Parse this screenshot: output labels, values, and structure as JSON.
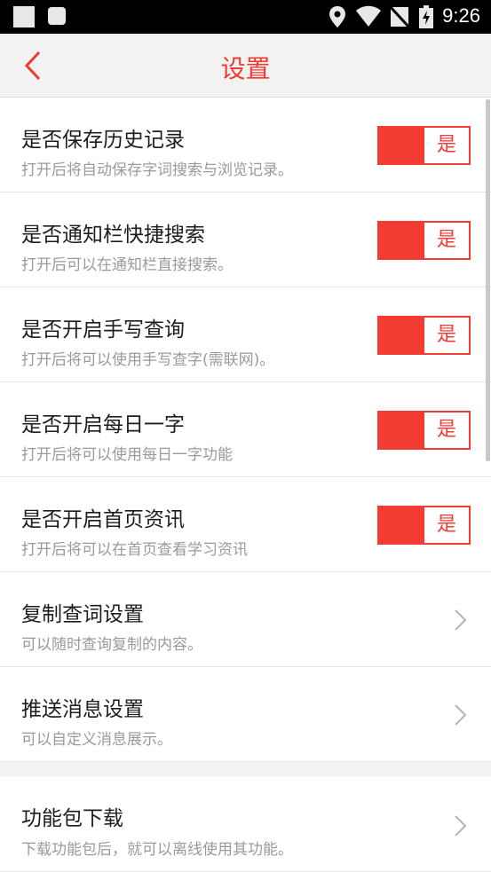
{
  "status_bar": {
    "time": "9:26"
  },
  "header": {
    "title": "设置"
  },
  "settings": [
    {
      "title": "是否保存历史记录",
      "desc": "打开后将自动保存字词搜索与浏览记录。",
      "toggle_label": "是"
    },
    {
      "title": "是否通知栏快捷搜索",
      "desc": "打开后可以在通知栏直接搜索。",
      "toggle_label": "是"
    },
    {
      "title": "是否开启手写查询",
      "desc": "打开后将可以使用手写查字(需联网)。",
      "toggle_label": "是"
    },
    {
      "title": "是否开启每日一字",
      "desc": "打开后将可以使用每日一字功能",
      "toggle_label": "是"
    },
    {
      "title": "是否开启首页资讯",
      "desc": "打开后将可以在首页查看学习资讯",
      "toggle_label": "是"
    },
    {
      "title": "复制查词设置",
      "desc": "可以随时查询复制的内容。"
    },
    {
      "title": "推送消息设置",
      "desc": "可以自定义消息展示。"
    },
    {
      "title": "功能包下载",
      "desc": "下载功能包后，就可以离线使用其功能。"
    }
  ],
  "colors": {
    "accent": "#f23b33",
    "background": "#f2f2f2"
  }
}
